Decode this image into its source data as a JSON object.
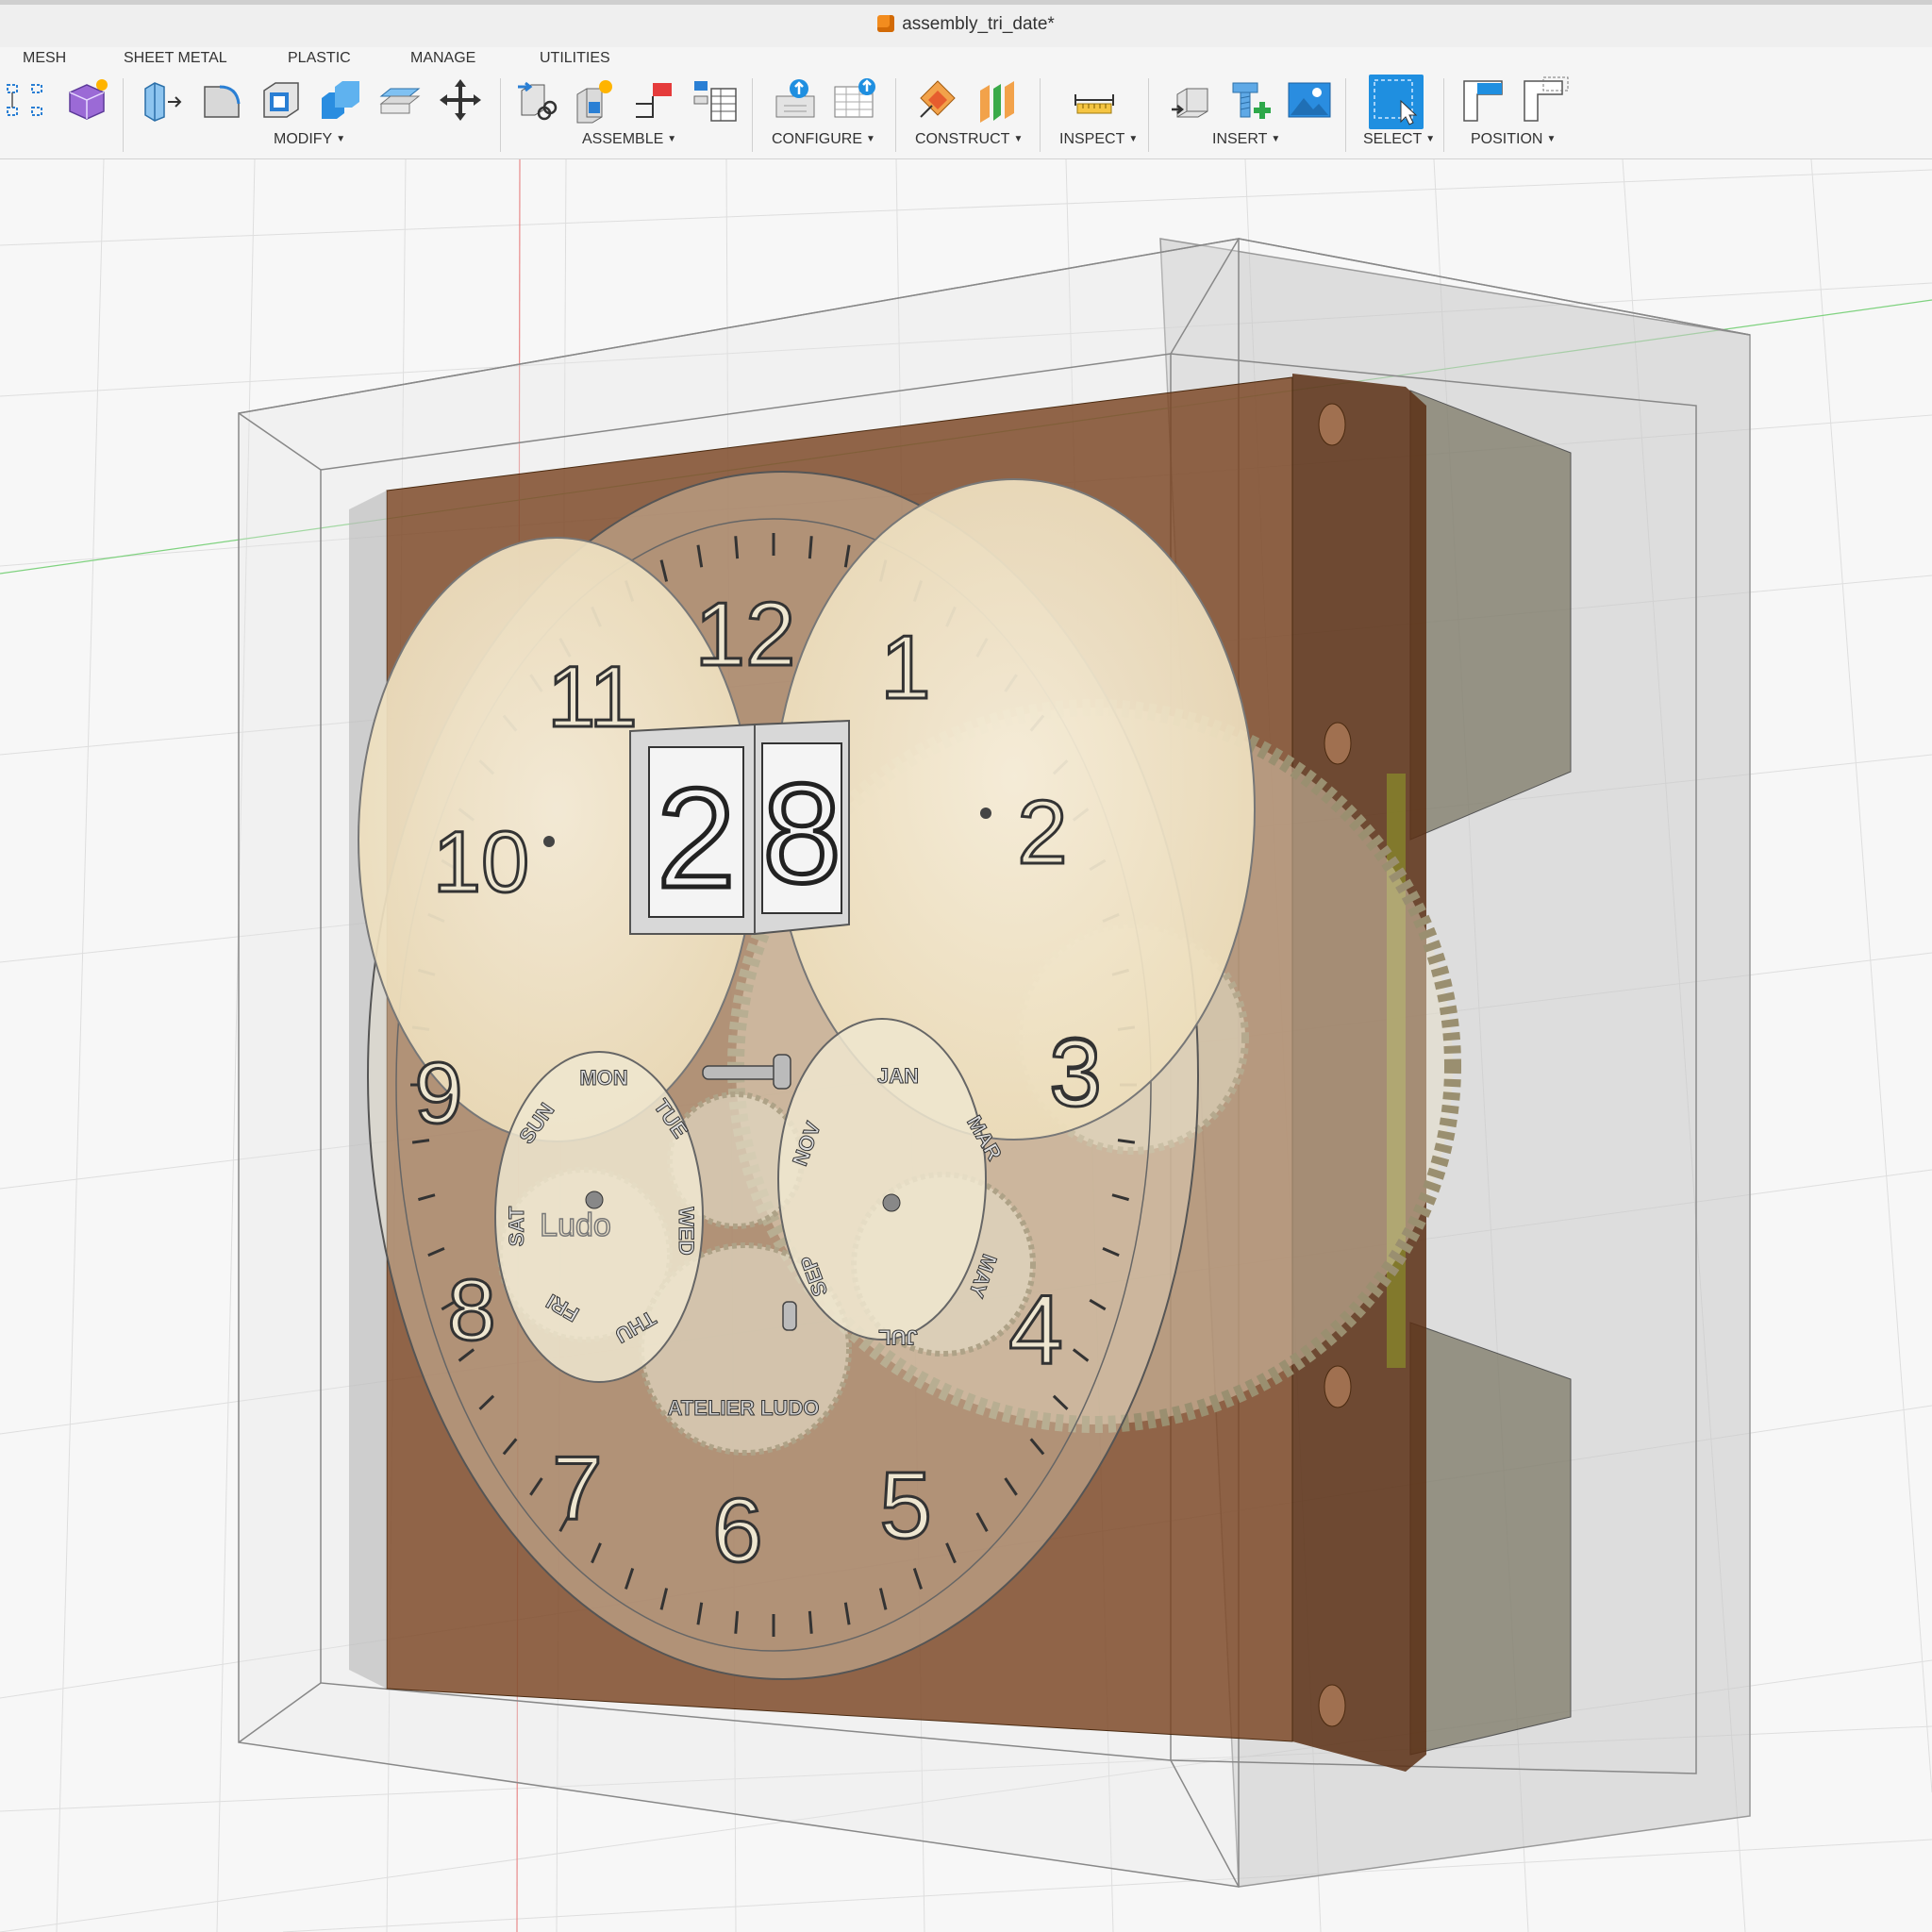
{
  "window": {
    "title": "assembly_tri_date*"
  },
  "tabs": [
    "MESH",
    "SHEET METAL",
    "PLASTIC",
    "MANAGE",
    "UTILITIES"
  ],
  "groups": {
    "modify": "MODIFY",
    "assemble": "ASSEMBLE",
    "configure": "CONFIGURE",
    "construct": "CONSTRUCT",
    "inspect": "INSPECT",
    "insert": "INSERT",
    "select": "SELECT",
    "position": "POSITION"
  },
  "icons": {
    "mesh_tree": "mesh-tree-icon",
    "mesh_create": "mesh-create-icon",
    "press_pull": "press-pull-icon",
    "fillet": "fillet-icon",
    "shell": "shell-icon",
    "combine": "combine-icon",
    "offset_face": "offset-face-icon",
    "move": "move-icon",
    "joint": "joint-icon",
    "new_component": "new-component-icon",
    "rigid_group": "rigid-group-icon",
    "bom": "bom-icon",
    "configure_insert": "configure-insert-icon",
    "configure_table": "configure-table-icon",
    "offset_plane": "offset-plane-icon",
    "midplane": "midplane-icon",
    "measure": "measure-icon",
    "insert_derive": "insert-derive-icon",
    "insert_mcmaster": "insert-mcmaster-icon",
    "insert_canvas": "insert-canvas-icon",
    "select": "select-icon",
    "capture_position": "capture-position-icon",
    "revert_position": "revert-position-icon"
  },
  "model": {
    "date_digits": [
      "2",
      "8"
    ],
    "left_dial_numerals": [
      "12",
      "11",
      "10",
      "9",
      "8",
      "7",
      "6",
      "5",
      "4",
      "3"
    ],
    "right_dial_numerals": [
      "1",
      "2",
      "3"
    ],
    "day_labels": [
      "SUN",
      "MON",
      "TUE",
      "WED",
      "THU",
      "FRI",
      "SAT"
    ],
    "month_labels": [
      "JAN",
      "MAR",
      "MAY",
      "JUL",
      "SEP",
      "NOV"
    ],
    "brand": "ATELIER LUDO",
    "subdial_marks": [
      "Ludo"
    ]
  },
  "colors": {
    "accent": "#1f8fe0",
    "backplate": "#6b3a1d",
    "dial": "#f3e8cf",
    "grid": "#dcdcdc"
  }
}
